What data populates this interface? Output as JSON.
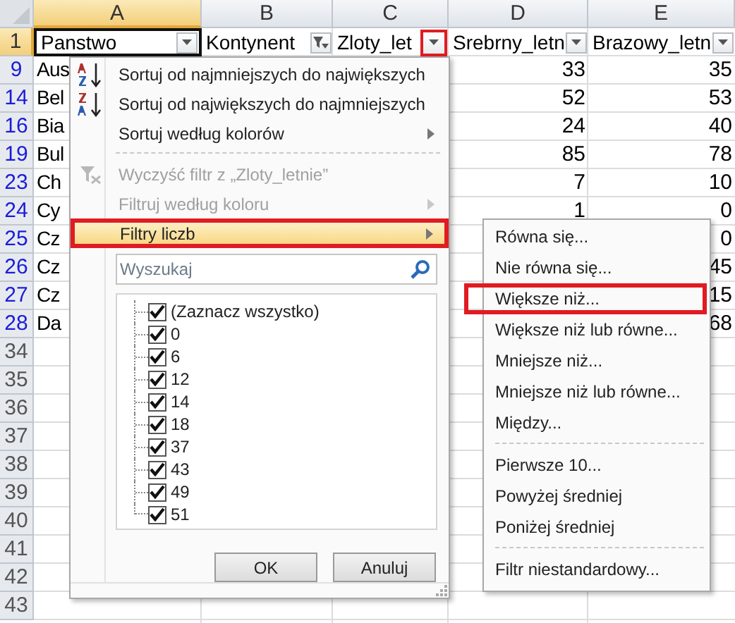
{
  "columns": [
    {
      "letter": "A",
      "selected": true
    },
    {
      "letter": "B",
      "selected": false
    },
    {
      "letter": "C",
      "selected": false
    },
    {
      "letter": "D",
      "selected": false
    },
    {
      "letter": "E",
      "selected": false
    }
  ],
  "header_row": {
    "number": "1",
    "selected": true,
    "cells": [
      {
        "label": "Panstwo",
        "filtered": false,
        "highlighted": false,
        "active_cell": true
      },
      {
        "label": "Kontynent",
        "filtered": true,
        "highlighted": false,
        "active_cell": false
      },
      {
        "label": "Zloty_let",
        "filtered": false,
        "highlighted": true,
        "active_cell": false
      },
      {
        "label": "Srebrny_letn",
        "filtered": false,
        "highlighted": false,
        "active_cell": false
      },
      {
        "label": "Brazowy_letn",
        "filtered": false,
        "highlighted": false,
        "active_cell": false
      }
    ]
  },
  "rows": [
    {
      "number": "9",
      "filtered": true,
      "cells": [
        "Aus",
        null,
        null,
        "33",
        "35"
      ]
    },
    {
      "number": "14",
      "filtered": true,
      "cells": [
        "Bel",
        null,
        null,
        "52",
        "53"
      ]
    },
    {
      "number": "16",
      "filtered": true,
      "cells": [
        "Bia",
        null,
        null,
        "24",
        "40"
      ]
    },
    {
      "number": "19",
      "filtered": true,
      "cells": [
        "Bul",
        null,
        null,
        "85",
        "78"
      ]
    },
    {
      "number": "23",
      "filtered": true,
      "cells": [
        "Ch",
        null,
        null,
        "7",
        "10"
      ]
    },
    {
      "number": "24",
      "filtered": true,
      "cells": [
        "Cy",
        null,
        null,
        "1",
        "0"
      ]
    },
    {
      "number": "25",
      "filtered": true,
      "cells": [
        "Cz",
        null,
        null,
        null,
        "0"
      ]
    },
    {
      "number": "26",
      "filtered": true,
      "cells": [
        "Cz",
        null,
        null,
        null,
        "45"
      ]
    },
    {
      "number": "27",
      "filtered": true,
      "cells": [
        "Cz",
        null,
        null,
        null,
        "15"
      ]
    },
    {
      "number": "28",
      "filtered": true,
      "cells": [
        "Da",
        null,
        null,
        null,
        "68"
      ]
    },
    {
      "number": "34",
      "filtered": false,
      "cells": [
        null,
        null,
        null,
        null,
        null
      ]
    },
    {
      "number": "35",
      "filtered": false,
      "cells": [
        null,
        null,
        null,
        null,
        null
      ]
    },
    {
      "number": "36",
      "filtered": false,
      "cells": [
        null,
        null,
        null,
        null,
        null
      ]
    },
    {
      "number": "37",
      "filtered": false,
      "cells": [
        null,
        null,
        null,
        null,
        null
      ]
    },
    {
      "number": "38",
      "filtered": false,
      "cells": [
        null,
        null,
        null,
        null,
        null
      ]
    },
    {
      "number": "39",
      "filtered": false,
      "cells": [
        null,
        null,
        null,
        null,
        null
      ]
    },
    {
      "number": "40",
      "filtered": false,
      "cells": [
        null,
        null,
        null,
        null,
        null
      ]
    },
    {
      "number": "41",
      "filtered": false,
      "cells": [
        null,
        null,
        null,
        null,
        null
      ]
    },
    {
      "number": "42",
      "filtered": false,
      "cells": [
        null,
        null,
        null,
        null,
        null
      ]
    },
    {
      "number": "43",
      "filtered": false,
      "cells": [
        null,
        null,
        null,
        null,
        null
      ]
    }
  ],
  "filter_menu": {
    "items": [
      {
        "kind": "sort_asc",
        "label": "Sortuj od najmniejszych do największych",
        "disabled": false,
        "submenu": false,
        "active": false,
        "highlighted": false
      },
      {
        "kind": "sort_desc",
        "label": "Sortuj od największych do najmniejszych",
        "disabled": false,
        "submenu": false,
        "active": false,
        "highlighted": false
      },
      {
        "kind": "item",
        "label": "Sortuj według kolorów",
        "disabled": false,
        "submenu": true,
        "active": false,
        "highlighted": false
      },
      {
        "kind": "separator"
      },
      {
        "kind": "clear_filter",
        "label": "Wyczyść filtr z „Zloty_letnie”",
        "disabled": true,
        "submenu": false,
        "active": false,
        "highlighted": false
      },
      {
        "kind": "item",
        "label": "Filtruj według koloru",
        "disabled": true,
        "submenu": true,
        "active": false,
        "highlighted": false
      },
      {
        "kind": "item",
        "label": "Filtry liczb",
        "disabled": false,
        "submenu": true,
        "active": true,
        "highlighted": true
      }
    ],
    "search": {
      "placeholder": "Wyszukaj"
    },
    "values": [
      {
        "label": "(Zaznacz wszystko)",
        "checked": true
      },
      {
        "label": "0",
        "checked": true
      },
      {
        "label": "6",
        "checked": true
      },
      {
        "label": "12",
        "checked": true
      },
      {
        "label": "14",
        "checked": true
      },
      {
        "label": "18",
        "checked": true
      },
      {
        "label": "37",
        "checked": true
      },
      {
        "label": "43",
        "checked": true
      },
      {
        "label": "49",
        "checked": true
      },
      {
        "label": "51",
        "checked": true
      }
    ],
    "buttons": [
      "OK",
      "Anuluj"
    ]
  },
  "number_filters_menu": {
    "items": [
      {
        "kind": "item",
        "label": "Równa się...",
        "highlighted": false
      },
      {
        "kind": "item",
        "label": "Nie równa się...",
        "highlighted": false
      },
      {
        "kind": "item",
        "label": "Większe niż...",
        "highlighted": true
      },
      {
        "kind": "item",
        "label": "Większe niż lub równe...",
        "highlighted": false
      },
      {
        "kind": "item",
        "label": "Mniejsze niż...",
        "highlighted": false
      },
      {
        "kind": "item",
        "label": "Mniejsze niż lub równe...",
        "highlighted": false
      },
      {
        "kind": "item",
        "label": "Między...",
        "highlighted": false
      },
      {
        "kind": "separator"
      },
      {
        "kind": "item",
        "label": "Pierwsze 10...",
        "highlighted": false
      },
      {
        "kind": "item",
        "label": "Powyżej średniej",
        "highlighted": false
      },
      {
        "kind": "item",
        "label": "Poniżej średniej",
        "highlighted": false
      },
      {
        "kind": "separator"
      },
      {
        "kind": "item",
        "label": "Filtr niestandardowy...",
        "highlighted": false
      }
    ]
  }
}
